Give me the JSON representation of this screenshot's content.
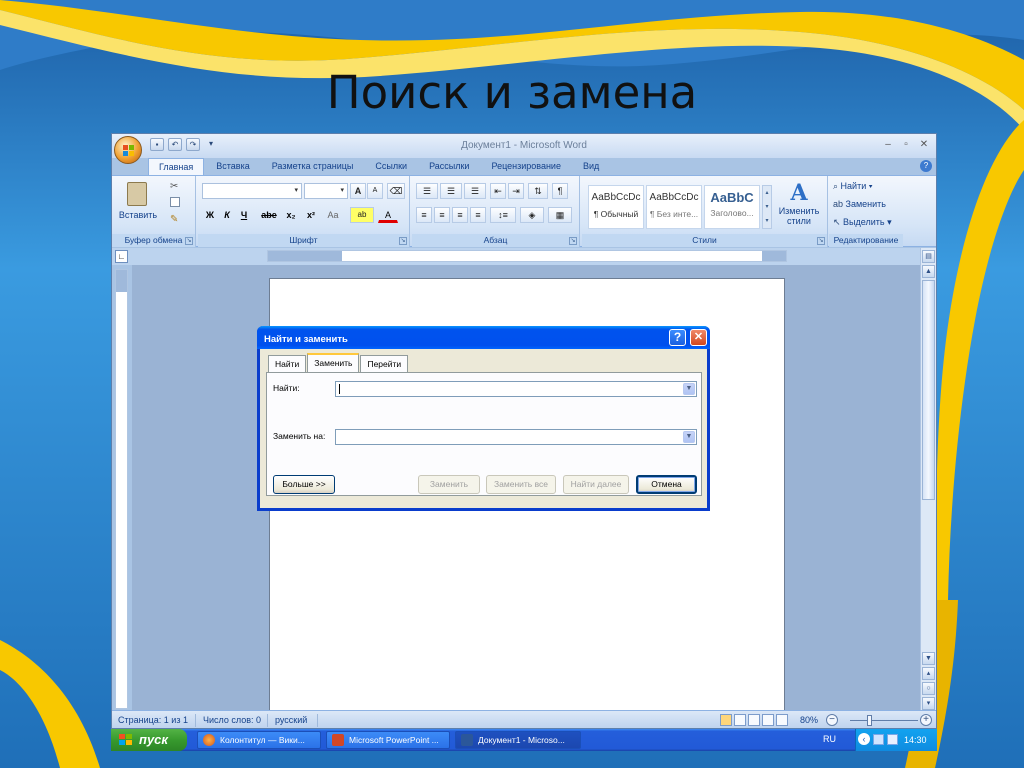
{
  "slide": {
    "title": "Поиск и замена"
  },
  "window": {
    "title": "Документ1 - Microsoft Word",
    "qat": {
      "save": "▪",
      "undo": "↶",
      "redo": "↷",
      "customize": "▾"
    },
    "controls": {
      "minimize": "–",
      "maximize": "▫",
      "close": "✕"
    }
  },
  "ribbon": {
    "tabs": [
      "Главная",
      "Вставка",
      "Разметка страницы",
      "Ссылки",
      "Рассылки",
      "Рецензирование",
      "Вид"
    ],
    "active_tab": "Главная",
    "help": "?",
    "clipboard": {
      "paste": "Вставить",
      "group": "Буфер обмена"
    },
    "font": {
      "group": "Шрифт",
      "grow": "A",
      "shrink": "A",
      "bold": "Ж",
      "italic": "К",
      "underline": "Ч",
      "strike": "abe",
      "sub": "x₂",
      "sup": "x²",
      "case": "Aa",
      "highlight": "ab",
      "font_color": "A"
    },
    "paragraph": {
      "group": "Абзац"
    },
    "styles": {
      "group": "Стили",
      "tiles": [
        {
          "sample": "AaBbCcDc",
          "name": "¶ Обычный"
        },
        {
          "sample": "AaBbCcDc",
          "name": "¶ Без инте..."
        },
        {
          "sample": "AaBbC",
          "name": "Заголово..."
        }
      ],
      "change_styles": "Изменить стили"
    },
    "editing": {
      "group": "Редактирование",
      "find": "Найти",
      "replace": "Заменить",
      "select": "Выделить"
    }
  },
  "ruler": {
    "tab_selector": "∟"
  },
  "dialog": {
    "title": "Найти и заменить",
    "help": "?",
    "close": "✕",
    "tabs": [
      "Найти",
      "Заменить",
      "Перейти"
    ],
    "active_tab": "Заменить",
    "find_label": "Найти:",
    "find_value": "",
    "replace_label": "Заменить на:",
    "replace_value": "",
    "buttons": {
      "more": "Больше >>",
      "replace": "Заменить",
      "replace_all": "Заменить все",
      "find_next": "Найти далее",
      "cancel": "Отмена"
    }
  },
  "statusbar": {
    "page": "Страница: 1 из 1",
    "words": "Число слов: 0",
    "language": "русский",
    "zoom": "80%",
    "zoom_level_percent": 80
  },
  "taskbar": {
    "start": "пуск",
    "tasks": [
      {
        "label": "Колонтитул — Вики...",
        "icon": "firefox-icon",
        "active": false
      },
      {
        "label": "Microsoft PowerPoint ...",
        "icon": "powerpoint-icon",
        "active": false
      },
      {
        "label": "Документ1 - Microso...",
        "icon": "word-icon",
        "active": true
      }
    ],
    "lang": "RU",
    "clock": "14:30"
  },
  "colors": {
    "slide_bg": "#2a87cf",
    "ribbon_band": "#f8c800",
    "dialog_title": "#0053ee",
    "start_green": "#389a2e",
    "taskbar_blue": "#225ad7"
  }
}
